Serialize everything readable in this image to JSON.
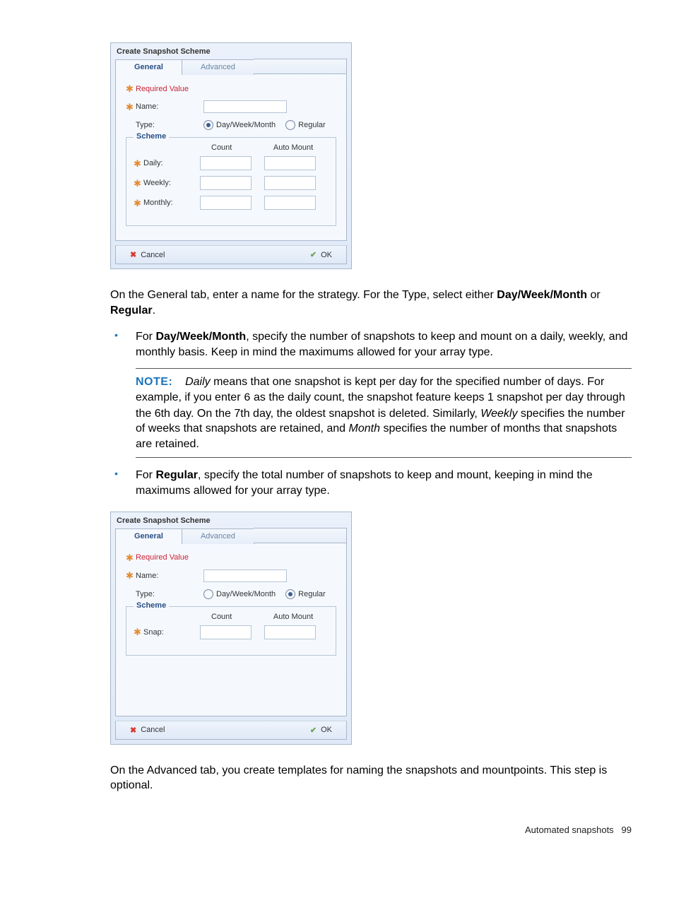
{
  "dialog1": {
    "title": "Create Snapshot Scheme",
    "tab_general": "General",
    "tab_advanced": "Advanced",
    "required_value": "Required Value",
    "name_label": "Name:",
    "type_label": "Type:",
    "type_option_dwm": "Day/Week/Month",
    "type_option_regular": "Regular",
    "fieldset_legend": "Scheme",
    "hdr_count": "Count",
    "hdr_automount": "Auto Mount",
    "row_daily": "Daily:",
    "row_weekly": "Weekly:",
    "row_monthly": "Monthly:",
    "btn_cancel": "Cancel",
    "btn_ok": "OK"
  },
  "para_general_intro_1": "On the General tab, enter a name for the strategy. For the Type, select either ",
  "para_general_intro_bold1": "Day/Week/Month",
  "para_general_intro_2": " or ",
  "para_general_intro_bold2": "Regular",
  "para_general_intro_3": ".",
  "bullet_dwm_1": "For ",
  "bullet_dwm_bold": "Day/Week/Month",
  "bullet_dwm_2": ", specify the number of snapshots to keep and mount on a daily, weekly, and monthly basis. Keep in mind the maximums allowed for your array type.",
  "note_label": "NOTE:",
  "note_1": "Daily",
  "note_2": " means that one snapshot is kept per day for the specified number of days. For example, if you enter ",
  "note_mono": "6",
  "note_3": " as the daily count, the snapshot feature keeps 1 snapshot per day through the 6th day. On the 7th day, the oldest snapshot is deleted. Similarly, ",
  "note_4": "Weekly",
  "note_5": " specifies the number of weeks that snapshots are retained, and ",
  "note_6": "Month",
  "note_7": " specifies the number of months that snapshots are retained.",
  "bullet_reg_1": "For ",
  "bullet_reg_bold": "Regular",
  "bullet_reg_2": ", specify the total number of snapshots to keep and mount, keeping in mind the maximums allowed for your array type.",
  "dialog2": {
    "title": "Create Snapshot Scheme",
    "tab_general": "General",
    "tab_advanced": "Advanced",
    "required_value": "Required Value",
    "name_label": "Name:",
    "type_label": "Type:",
    "type_option_dwm": "Day/Week/Month",
    "type_option_regular": "Regular",
    "fieldset_legend": "Scheme",
    "hdr_count": "Count",
    "hdr_automount": "Auto Mount",
    "row_snap": "Snap:",
    "btn_cancel": "Cancel",
    "btn_ok": "OK"
  },
  "para_advanced": "On the Advanced tab, you create templates for naming the snapshots and mountpoints. This step is optional.",
  "footer_text": "Automated snapshots",
  "footer_page": "99"
}
